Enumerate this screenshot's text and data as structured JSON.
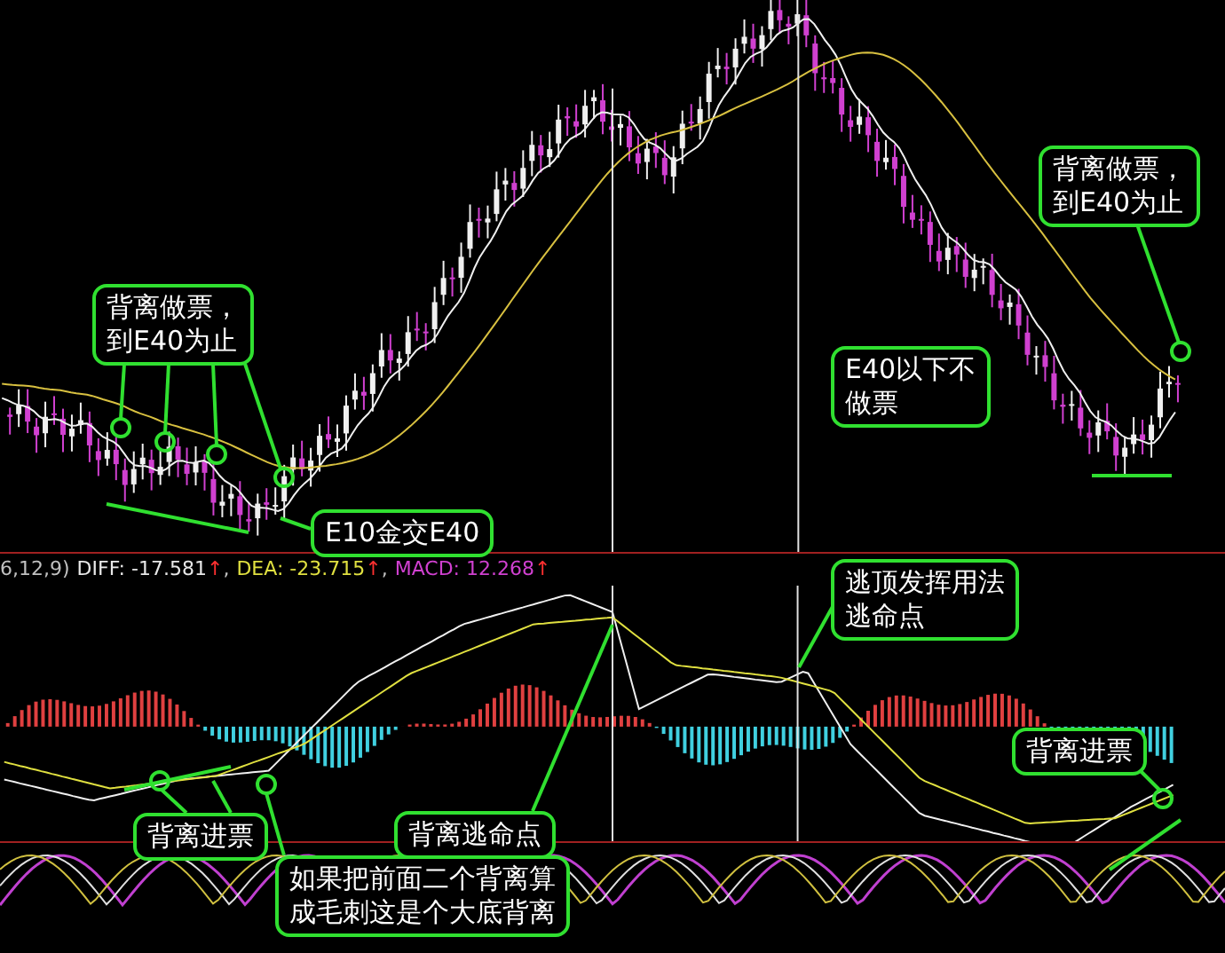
{
  "macd_legend": {
    "params": "6,12,9)",
    "items": [
      {
        "label": "DIFF: -17.581",
        "arrow": "↑",
        "separator": ",",
        "color": "#e8e8e8"
      },
      {
        "label": "DEA: -23.715",
        "arrow": "↑",
        "separator": ",",
        "color": "#e0e040"
      },
      {
        "label": "MACD: 12.268",
        "arrow": "↑",
        "color": "#d040d0"
      }
    ]
  },
  "callouts": [
    {
      "lines": [
        "背离做票，",
        "到E40为止"
      ]
    },
    {
      "lines": [
        "背离做票，",
        "到E40为止"
      ]
    },
    {
      "lines": [
        "E40以下不",
        "做票"
      ]
    },
    {
      "lines": [
        "E10金交E40"
      ]
    },
    {
      "lines": [
        "逃顶发挥用法",
        "逃命点"
      ]
    },
    {
      "lines": [
        "背离进票"
      ]
    },
    {
      "lines": [
        "背离进票"
      ]
    },
    {
      "lines": [
        "背离逃命点"
      ]
    },
    {
      "lines": [
        "如果把前面二个背离算",
        "成毛刺这是个大底背离"
      ]
    }
  ]
}
